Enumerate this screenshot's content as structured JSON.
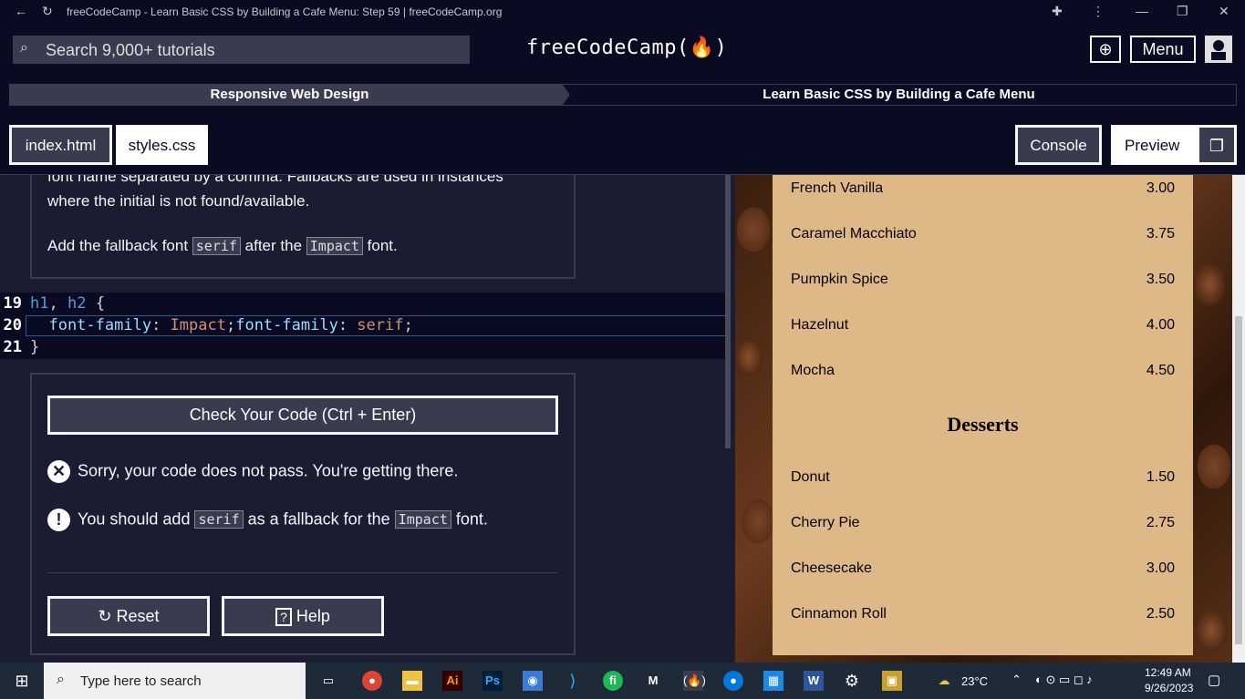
{
  "browser": {
    "title": "freeCodeCamp - Learn Basic CSS by Building a Cafe Menu: Step 59 | freeCodeCamp.org"
  },
  "navbar": {
    "search_placeholder": "Search 9,000+ tutorials",
    "brand": "freeCodeCamp(🔥)",
    "menu_label": "Menu"
  },
  "breadcrumbs": [
    "Responsive Web Design",
    "Learn Basic CSS by Building a Cafe Menu"
  ],
  "tabs": {
    "files": [
      "index.html",
      "styles.css"
    ],
    "console": "Console",
    "preview": "Preview"
  },
  "description": {
    "line1": "font name separated by a comma. Fallbacks are used in instances",
    "line2": "where the initial is not found/available.",
    "add_pre": "Add the fallback font ",
    "code1": "serif",
    "add_mid": " after the ",
    "code2": "Impact",
    "add_post": " font."
  },
  "editor": {
    "lines": [
      {
        "num": "19",
        "text": "h1, h2 {"
      },
      {
        "num": "20",
        "text": "  font-family: Impact;font-family: serif;"
      },
      {
        "num": "21",
        "text": "}"
      }
    ]
  },
  "panel": {
    "check_button": "Check Your Code (Ctrl + Enter)",
    "fail_message": "Sorry, your code does not pass. You're getting there.",
    "hint_pre": "You should add ",
    "hint_code1": "serif",
    "hint_mid": " as a fallback for the ",
    "hint_code2": "Impact",
    "hint_post": " font.",
    "reset_label": "Reset",
    "help_label": "Help"
  },
  "preview_menu": {
    "coffee": [
      {
        "name": "French Vanilla",
        "price": "3.00"
      },
      {
        "name": "Caramel Macchiato",
        "price": "3.75"
      },
      {
        "name": "Pumpkin Spice",
        "price": "3.50"
      },
      {
        "name": "Hazelnut",
        "price": "4.00"
      },
      {
        "name": "Mocha",
        "price": "4.50"
      }
    ],
    "desserts_heading": "Desserts",
    "desserts": [
      {
        "name": "Donut",
        "price": "1.50"
      },
      {
        "name": "Cherry Pie",
        "price": "2.75"
      },
      {
        "name": "Cheesecake",
        "price": "3.00"
      },
      {
        "name": "Cinnamon Roll",
        "price": "2.50"
      }
    ]
  },
  "taskbar": {
    "search_placeholder": "Type here to search",
    "weather": "23°C",
    "time": "12:49 AM",
    "date": "9/26/2023"
  },
  "colors": {
    "bg": "#0a0a23",
    "panel_bg": "#1b1b32",
    "gray": "#3b3b4f",
    "menu_bg": "#deb887",
    "keyword": "#569cd6",
    "property": "#9cdcfe",
    "value": "#ce9178"
  }
}
